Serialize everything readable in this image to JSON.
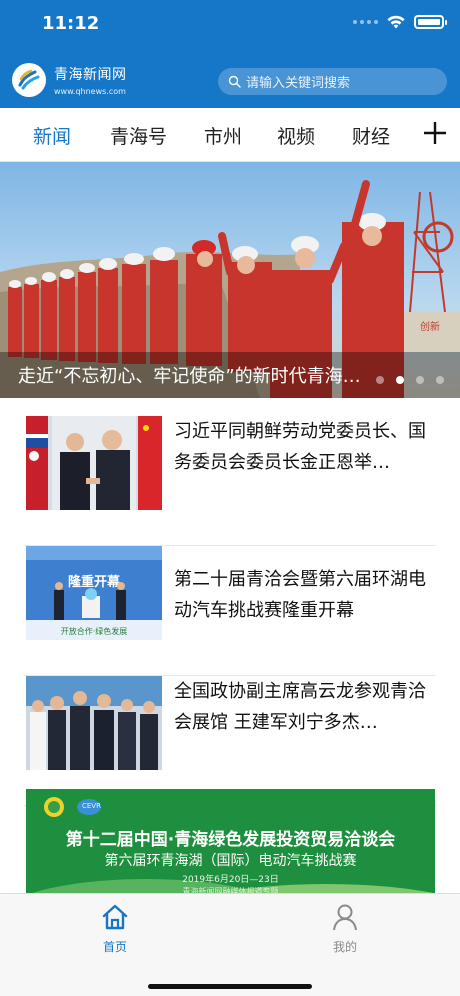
{
  "status_bar": {
    "time": "11:12"
  },
  "header": {
    "brand_name": "青海新闻网",
    "brand_url": "www.qhnews.com",
    "search_placeholder": "请输入关键词搜索"
  },
  "tabs": [
    {
      "label": "新闻",
      "active": true
    },
    {
      "label": "青海号",
      "active": false
    },
    {
      "label": "市州",
      "active": false
    },
    {
      "label": "视频",
      "active": false
    },
    {
      "label": "财经",
      "active": false
    }
  ],
  "banner": {
    "caption": "走近“不忘初心、牢记使命”的新时代青海…",
    "page_count": 5,
    "current_page": 2,
    "sign_text": "创新"
  },
  "news": [
    {
      "title": "习近平同朝鲜劳动党委员长、国务委员会委员长金正恩举…"
    },
    {
      "title": "第二十届青洽会暨第六届环湖电动汽车挑战赛隆重开幕",
      "thumb_text": "隆重开幕",
      "thumb_bottom_text": "开放合作·绿色发展"
    },
    {
      "title": "全国政协副主席高云龙参观青洽会展馆 王建军刘宁多杰…"
    }
  ],
  "ad": {
    "title": "第十二届中国·青海绿色发展投资贸易洽谈会",
    "subtitle": "第六届环青海湖（国际）电动汽车挑战赛",
    "date": "2019年6月20日—23日",
    "footer": "青海新闻网融媒体报道专题",
    "logo_text": "CEVR"
  },
  "bottom_nav": [
    {
      "label": "首页",
      "active": true
    },
    {
      "label": "我的",
      "active": false
    }
  ],
  "colors": {
    "accent": "#1677c8",
    "inactive": "#8a8a8a"
  }
}
